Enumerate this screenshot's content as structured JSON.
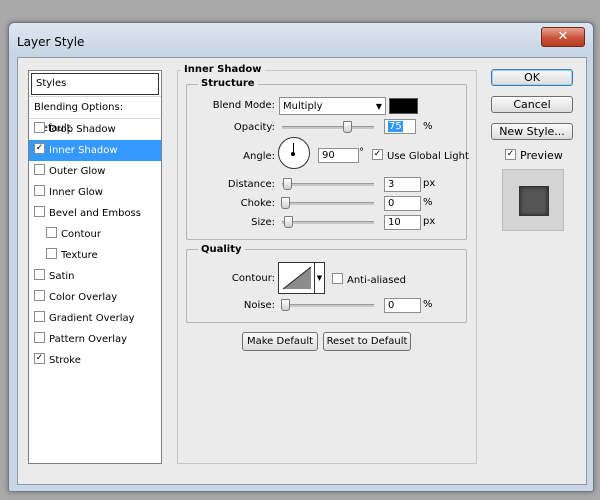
{
  "window": {
    "title": "Layer Style",
    "close_glyph": "✕"
  },
  "styles_panel": {
    "header": "Styles",
    "blending_options": "Blending Options: Default",
    "items": [
      {
        "label": "Drop Shadow",
        "checked": false,
        "selected": false,
        "sub": false
      },
      {
        "label": "Inner Shadow",
        "checked": true,
        "selected": true,
        "sub": false
      },
      {
        "label": "Outer Glow",
        "checked": false,
        "selected": false,
        "sub": false
      },
      {
        "label": "Inner Glow",
        "checked": false,
        "selected": false,
        "sub": false
      },
      {
        "label": "Bevel and Emboss",
        "checked": false,
        "selected": false,
        "sub": false
      },
      {
        "label": "Contour",
        "checked": false,
        "selected": false,
        "sub": true
      },
      {
        "label": "Texture",
        "checked": false,
        "selected": false,
        "sub": true
      },
      {
        "label": "Satin",
        "checked": false,
        "selected": false,
        "sub": false
      },
      {
        "label": "Color Overlay",
        "checked": false,
        "selected": false,
        "sub": false
      },
      {
        "label": "Gradient Overlay",
        "checked": false,
        "selected": false,
        "sub": false
      },
      {
        "label": "Pattern Overlay",
        "checked": false,
        "selected": false,
        "sub": false
      },
      {
        "label": "Stroke",
        "checked": true,
        "selected": false,
        "sub": false
      }
    ]
  },
  "inner_shadow": {
    "section_title": "Inner Shadow",
    "structure": {
      "title": "Structure",
      "blend_mode_label": "Blend Mode:",
      "blend_mode_value": "Multiply",
      "shadow_color": "#000000",
      "opacity_label": "Opacity:",
      "opacity_value": "75",
      "opacity_unit": "%",
      "opacity_fraction": 0.75,
      "angle_label": "Angle:",
      "angle_value": "90",
      "angle_unit": "°",
      "use_global_light_label": "Use Global Light",
      "use_global_light": true,
      "distance_label": "Distance:",
      "distance_value": "3",
      "distance_unit": "px",
      "distance_fraction": 0.02,
      "choke_label": "Choke:",
      "choke_value": "0",
      "choke_unit": "%",
      "choke_fraction": 0.0,
      "size_label": "Size:",
      "size_value": "10",
      "size_unit": "px",
      "size_fraction": 0.04
    },
    "quality": {
      "title": "Quality",
      "contour_label": "Contour:",
      "anti_aliased_label": "Anti-aliased",
      "anti_aliased": false,
      "noise_label": "Noise:",
      "noise_value": "0",
      "noise_unit": "%",
      "noise_fraction": 0.0
    },
    "make_default_label": "Make Default",
    "reset_default_label": "Reset to Default"
  },
  "actions": {
    "ok_label": "OK",
    "cancel_label": "Cancel",
    "new_style_label": "New Style...",
    "preview_label": "Preview",
    "preview_checked": true
  }
}
